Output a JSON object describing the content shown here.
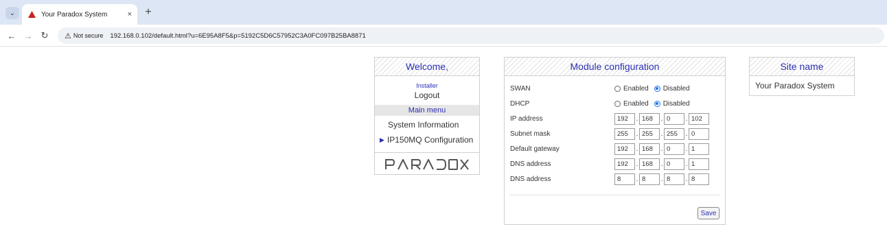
{
  "browser": {
    "tab_title": "Your Paradox System",
    "tab_close": "×",
    "new_tab": "+",
    "security_label": "Not secure",
    "url": "192.168.0.102/default.html?u=6E95A8F5&p=5192C5D6C57952C3A0FC097B25BA8871"
  },
  "left_panel": {
    "title": "Welcome,",
    "user": "Installer",
    "logout": "Logout",
    "menu_title": "Main menu",
    "menu_items": [
      "System Information",
      "IP150MQ Configuration"
    ],
    "logo": "PARADOX"
  },
  "config": {
    "title": "Module configuration",
    "swan": {
      "label": "SWAN",
      "options": [
        "Enabled",
        "Disabled"
      ],
      "selected": "Disabled"
    },
    "dhcp": {
      "label": "DHCP",
      "options": [
        "Enabled",
        "Disabled"
      ],
      "selected": "Disabled"
    },
    "ip_address": {
      "label": "IP address",
      "octets": [
        "192",
        "168",
        "0",
        "102"
      ]
    },
    "subnet_mask": {
      "label": "Subnet mask",
      "octets": [
        "255",
        "255",
        "255",
        "0"
      ]
    },
    "default_gateway": {
      "label": "Default gateway",
      "octets": [
        "192",
        "168",
        "0",
        "1"
      ]
    },
    "dns1": {
      "label": "DNS address",
      "octets": [
        "192",
        "168",
        "0",
        "1"
      ]
    },
    "dns2": {
      "label": "DNS address",
      "octets": [
        "8",
        "8",
        "8",
        "8"
      ]
    },
    "save_label": "Save"
  },
  "site": {
    "title": "Site name",
    "value": "Your Paradox System"
  },
  "colors": {
    "accent": "#2a2fb3",
    "radio_selected": "#1a73e8",
    "warning": "#c5221f"
  }
}
